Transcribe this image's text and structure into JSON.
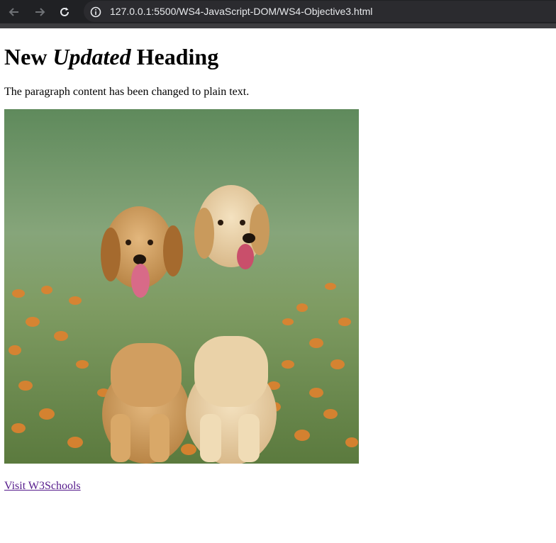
{
  "browser": {
    "url": "127.0.0.1:5500/WS4-JavaScript-DOM/WS4-Objective3.html",
    "icons": [
      "back-arrow-icon",
      "forward-arrow-icon",
      "reload-icon",
      "site-info-icon"
    ]
  },
  "page": {
    "heading": {
      "before": "New ",
      "emphasis": "Updated",
      "after": " Heading"
    },
    "paragraph": "The paragraph content has been changed to plain text.",
    "link_text": "Visit W3Schools"
  },
  "colors": {
    "link_visited": "#551a8b",
    "browser_bar": "#202124"
  }
}
